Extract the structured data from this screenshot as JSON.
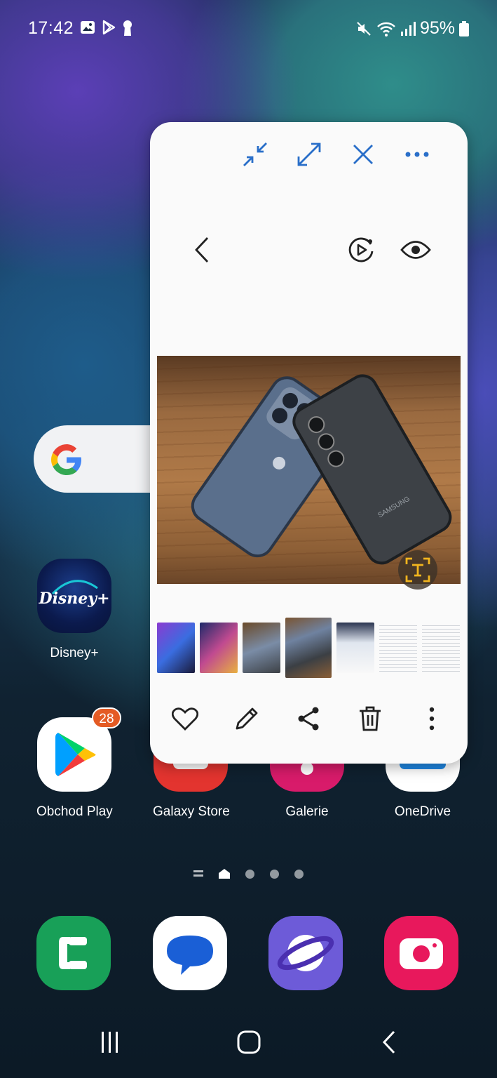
{
  "status_bar": {
    "time": "17:42",
    "battery": "95%",
    "left_icons": [
      "gallery-icon",
      "play-store-icon",
      "keyhole-icon"
    ],
    "right_icons": [
      "mute-icon",
      "wifi-icon",
      "signal-icon",
      "battery-icon"
    ]
  },
  "home": {
    "apps": [
      {
        "label": "Disney+"
      },
      {
        "label": "Obchod Play",
        "badge": "28"
      },
      {
        "label": "Galaxy Store"
      },
      {
        "label": "Galerie"
      },
      {
        "label": "OneDrive"
      }
    ],
    "disney_logo_text": "Disney+",
    "dock": [
      "phone",
      "messages",
      "internet",
      "camera"
    ],
    "pages": 3
  },
  "popup": {
    "window_controls": [
      "minimize-icon",
      "maximize-icon",
      "close-icon",
      "more-icon"
    ],
    "viewer_controls": [
      "back-icon",
      "motion-photo-icon",
      "view-icon"
    ],
    "photo_brand_text": "SAMSUNG",
    "thumbnails": 7,
    "active_thumbnail": 4,
    "actions": [
      "favorite-icon",
      "edit-icon",
      "share-icon",
      "delete-icon",
      "more-vertical-icon"
    ]
  },
  "colors": {
    "accent_blue": "#2a6fc9",
    "badge_orange": "#e45b24",
    "ocr_yellow": "#f2b51e"
  }
}
